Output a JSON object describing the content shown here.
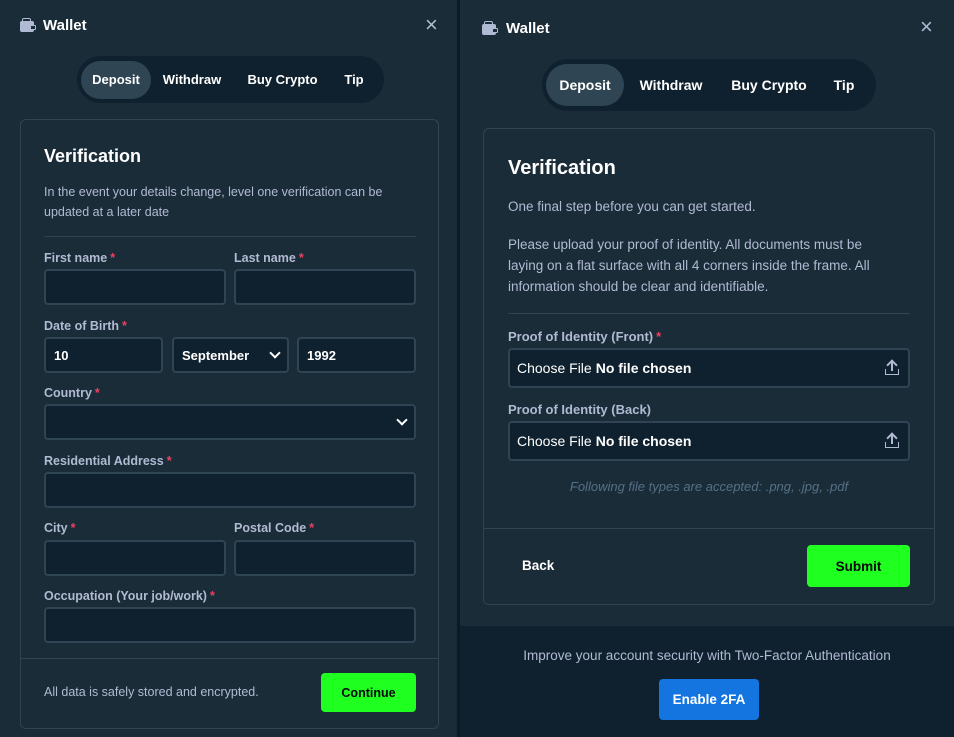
{
  "left": {
    "wallet_title": "Wallet",
    "tabs": [
      "Deposit",
      "Withdraw",
      "Buy Crypto",
      "Tip"
    ],
    "active_tab": "Deposit",
    "heading": "Verification",
    "description": "In the event your details change, level one verification can be updated at a later date",
    "fields": {
      "first_name": {
        "label": "First name",
        "value": ""
      },
      "last_name": {
        "label": "Last name",
        "value": ""
      },
      "dob": {
        "label": "Date of Birth",
        "day": "10",
        "month": "September",
        "year": "1992"
      },
      "country": {
        "label": "Country",
        "value": ""
      },
      "address": {
        "label": "Residential Address",
        "value": ""
      },
      "city": {
        "label": "City",
        "value": ""
      },
      "postal": {
        "label": "Postal Code",
        "value": ""
      },
      "occupation": {
        "label": "Occupation (Your job/work)",
        "value": ""
      }
    },
    "required_mark": "*",
    "footer_text": "All data is safely stored and encrypted.",
    "continue_label": "Continue"
  },
  "right": {
    "wallet_title": "Wallet",
    "tabs": [
      "Deposit",
      "Withdraw",
      "Buy Crypto",
      "Tip"
    ],
    "active_tab": "Deposit",
    "heading": "Verification",
    "intro": "One final step before you can get started.",
    "instructions": "Please upload your proof of identity. All documents must be laying on a flat surface with all 4 corners inside the frame. All information should be clear and identifiable.",
    "front_label": "Proof of Identity (Front)",
    "back_label": "Proof of Identity (Back)",
    "choose_file": "Choose File",
    "no_file": "No file chosen",
    "file_types_note": "Following file types are accepted: .png, .jpg, .pdf",
    "back_button": "Back",
    "submit_button": "Submit",
    "security_text": "Improve your account security with Two-Factor Authentication",
    "enable_2fa": "Enable 2FA"
  },
  "colors": {
    "background": "#1a2c38",
    "dark": "#0f212e",
    "border": "#2f4553",
    "accent_green": "#1fff20",
    "accent_blue": "#1475e1",
    "required": "#ed4163"
  },
  "icons": [
    "wallet-icon",
    "close-icon",
    "chevron-down-icon",
    "upload-icon"
  ]
}
